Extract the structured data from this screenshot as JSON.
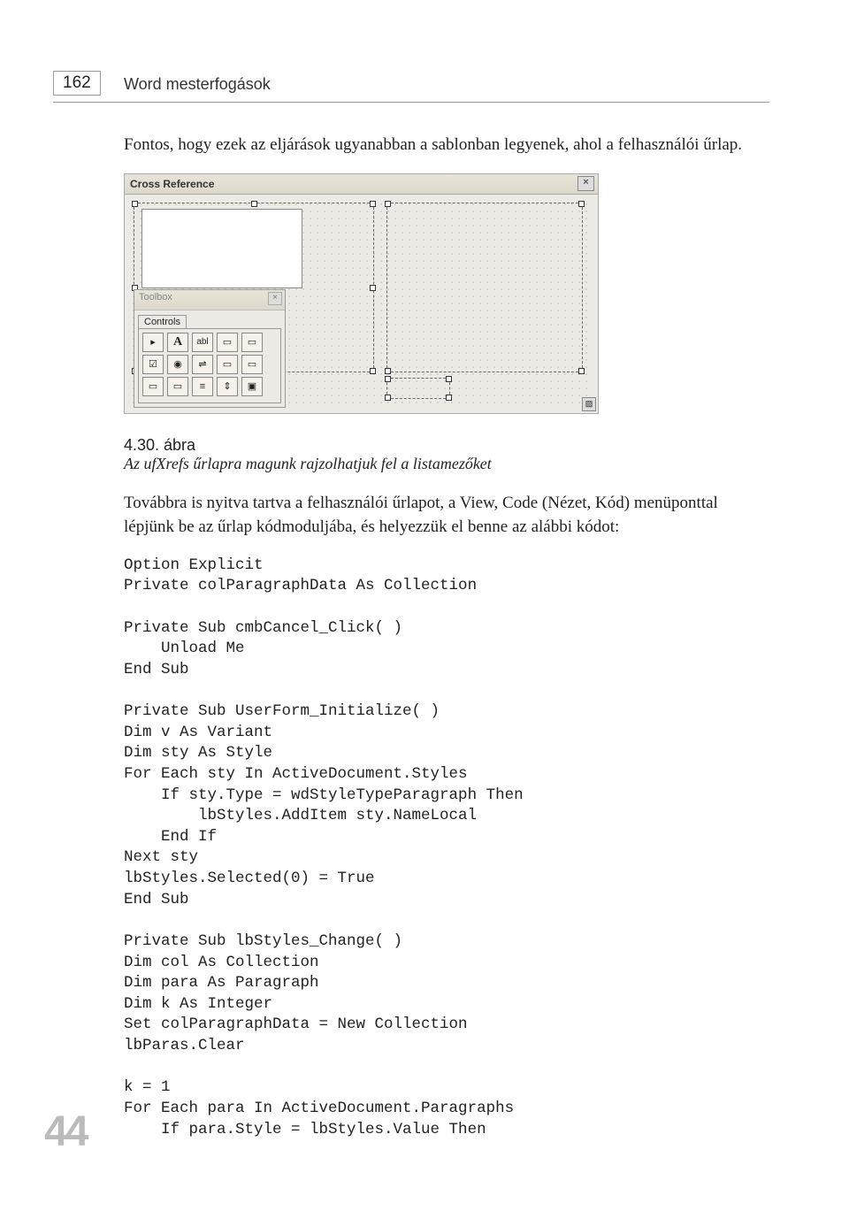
{
  "header": {
    "page_number": "162",
    "running_head": "Word mesterfogások"
  },
  "paragraph1": "Fontos, hogy ezek az eljárások ugyanabban a sablonban legyenek, ahol a felhasználói űrlap.",
  "figure": {
    "window_title": "Cross Reference",
    "toolbox_title": "Toolbox",
    "toolbox_tab": "Controls",
    "close_glyph": "×",
    "tools": {
      "r1": [
        "▸",
        "A",
        "abl",
        "▭",
        "▭"
      ],
      "r2": [
        "☑",
        "◉",
        "⇌",
        "▭",
        "▭"
      ],
      "r3": [
        "▭",
        "▭",
        "≡",
        "⇕",
        "▣"
      ]
    }
  },
  "caption": {
    "number": "4.30. ábra",
    "text": "Az ufXrefs űrlapra magunk rajzolhatjuk fel a listamezőket"
  },
  "paragraph2": "Továbbra is nyitva tartva a felhasználói űrlapot, a View, Code (Nézet, Kód) menüponttal lépjünk be az űrlap kódmoduljába, és helyezzük el benne az alábbi kódot:",
  "code1": "Option Explicit\nPrivate colParagraphData As Collection\n\nPrivate Sub cmbCancel_Click( )\n    Unload Me\nEnd Sub\n\nPrivate Sub UserForm_Initialize( )\nDim v As Variant\nDim sty As Style\nFor Each sty In ActiveDocument.Styles\n    If sty.Type = wdStyleTypeParagraph Then\n        lbStyles.AddItem sty.NameLocal\n    End If\nNext sty\nlbStyles.Selected(0) = True\nEnd Sub\n\nPrivate Sub lbStyles_Change( )\nDim col As Collection\nDim para As Paragraph\nDim k As Integer\nSet colParagraphData = New Collection\nlbParas.Clear\n\nk = 1\nFor Each para In ActiveDocument.Paragraphs\n    If para.Style = lbStyles.Value Then",
  "side_number": "44"
}
